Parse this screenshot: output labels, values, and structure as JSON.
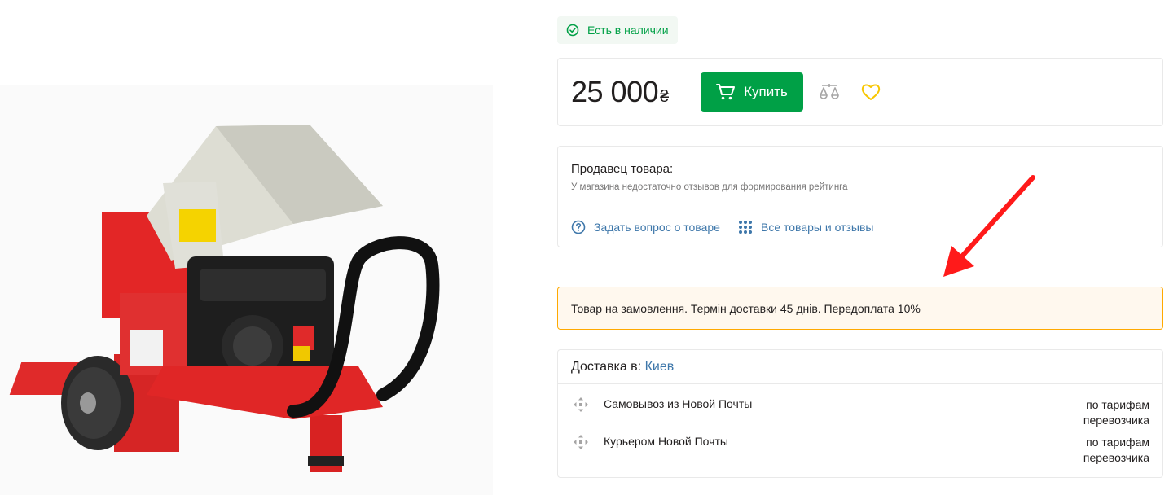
{
  "stock": {
    "label": "Есть в наличии",
    "icon": "check-circle-icon",
    "color": "#00a046"
  },
  "price": {
    "amount": "25 000",
    "currency": "₴"
  },
  "buy": {
    "label": "Купить",
    "icon": "cart-icon",
    "color": "#00a046"
  },
  "actions": {
    "compare_icon": "scales-icon",
    "wishlist_icon": "heart-icon"
  },
  "seller": {
    "title": "Продавец товара:",
    "note": "У магазина недостаточно отзывов для формирования рейтинга",
    "ask_label": "Задать вопрос о товаре",
    "all_label": "Все товары и отзывы"
  },
  "notice": {
    "text": "Товар на замовлення. Термін доставки 45 днів. Передоплата 10%",
    "border_color": "#ffa900"
  },
  "delivery": {
    "prefix": "Доставка в:",
    "city": "Киев",
    "options": [
      {
        "name": "Самовывоз из Новой Почты",
        "price": "по тарифам перевозчика",
        "icon": "move-icon"
      },
      {
        "name": "Курьером Новой Почты",
        "price": "по тарифам перевозчика",
        "icon": "move-icon"
      }
    ]
  },
  "colors": {
    "link": "#3e77aa",
    "accent": "#00a046",
    "annotation_arrow": "#ff0000"
  }
}
